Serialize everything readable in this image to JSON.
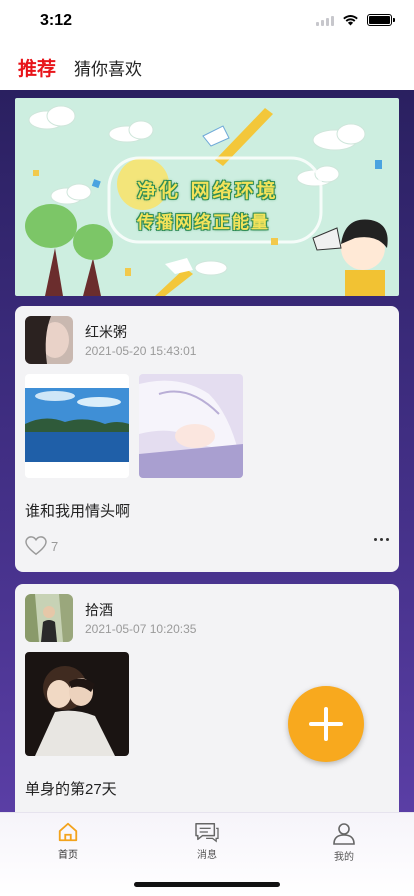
{
  "status_bar": {
    "time": "3:12"
  },
  "top_tabs": {
    "recommended": "推荐",
    "guess_you_like": "猜你喜欢"
  },
  "banner": {
    "line1": "净化 网络环境",
    "line2": "传播网络正能量"
  },
  "posts": [
    {
      "username": "红米粥",
      "timestamp": "2021-05-20 15:43:01",
      "text": "谁和我用情头啊",
      "likes": "7"
    },
    {
      "username": "拾酒",
      "timestamp": "2021-05-07 10:20:35",
      "text": "单身的第27天"
    }
  ],
  "fab": {
    "icon": "plus-icon",
    "color": "#f8a91e"
  },
  "tabbar": {
    "items": [
      {
        "label": "首页",
        "icon": "home-icon",
        "active": true
      },
      {
        "label": "消息",
        "icon": "message-icon",
        "active": false
      },
      {
        "label": "我的",
        "icon": "profile-icon",
        "active": false
      }
    ]
  },
  "colors": {
    "accent": "#f8a91e",
    "tab_active_text": "#e8141a",
    "tab_underline": "#2cc9a0"
  }
}
